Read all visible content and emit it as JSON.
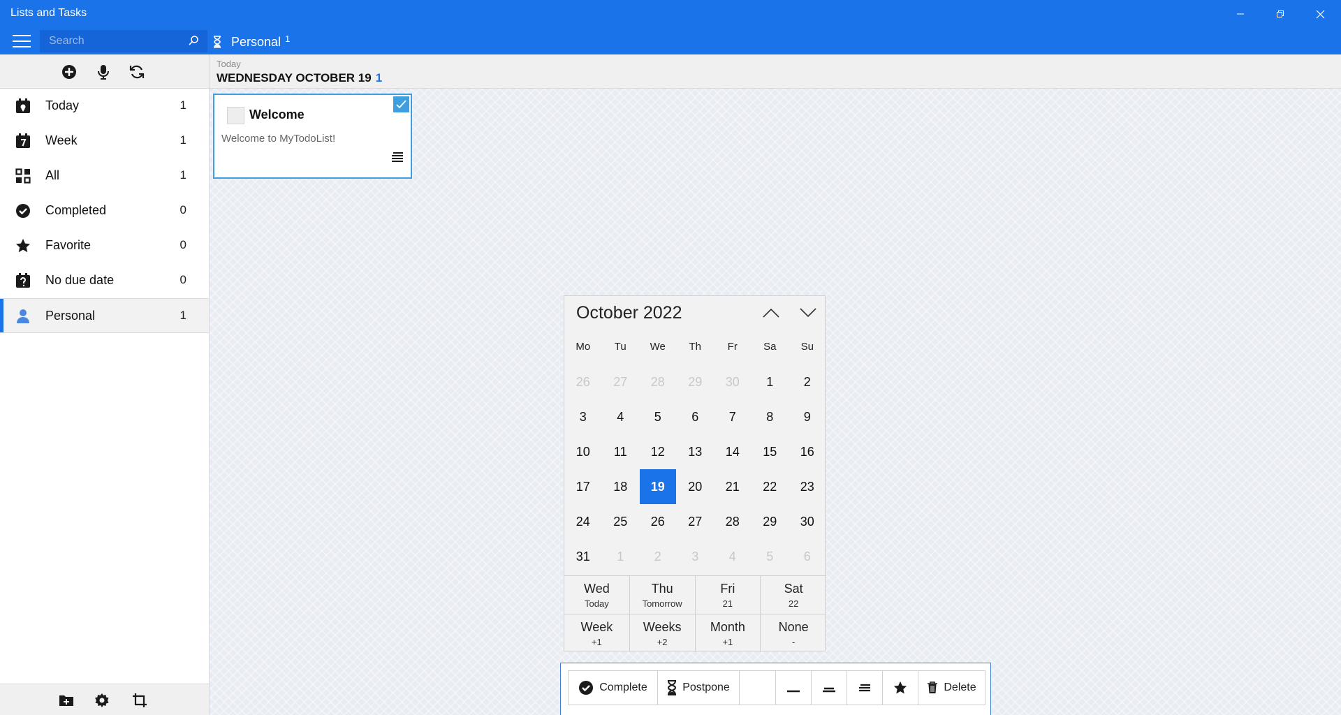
{
  "window": {
    "title": "Lists and Tasks",
    "controls": [
      "minimize-icon",
      "restore-icon",
      "close-icon"
    ]
  },
  "header": {
    "search_placeholder": "Search",
    "list_title": "Personal",
    "list_count": "1"
  },
  "sidebar": {
    "toolbar": [
      "add-icon",
      "microphone-icon",
      "sync-icon"
    ],
    "items": [
      {
        "label": "Today",
        "count": "1",
        "icon": "calendar-today-icon"
      },
      {
        "label": "Week",
        "count": "1",
        "icon": "calendar-week-icon"
      },
      {
        "label": "All",
        "count": "1",
        "icon": "grid-icon"
      },
      {
        "label": "Completed",
        "count": "0",
        "icon": "check-circle-icon"
      },
      {
        "label": "Favorite",
        "count": "0",
        "icon": "star-icon"
      },
      {
        "label": "No due date",
        "count": "0",
        "icon": "calendar-question-icon"
      },
      {
        "label": "Personal",
        "count": "1",
        "icon": "person-icon",
        "selected": true
      }
    ],
    "footer": [
      "add-folder-icon",
      "settings-icon",
      "crop-icon"
    ]
  },
  "main": {
    "today_label": "Today",
    "date_text": "WEDNESDAY OCTOBER 19",
    "date_count": "1",
    "task": {
      "title": "Welcome",
      "description": "Welcome to MyTodoList!"
    }
  },
  "calendar": {
    "month_label": "October 2022",
    "weekdays": [
      "Mo",
      "Tu",
      "We",
      "Th",
      "Fr",
      "Sa",
      "Su"
    ],
    "days": [
      {
        "d": "26",
        "other": true
      },
      {
        "d": "27",
        "other": true
      },
      {
        "d": "28",
        "other": true
      },
      {
        "d": "29",
        "other": true
      },
      {
        "d": "30",
        "other": true
      },
      {
        "d": "1"
      },
      {
        "d": "2"
      },
      {
        "d": "3"
      },
      {
        "d": "4"
      },
      {
        "d": "5"
      },
      {
        "d": "6"
      },
      {
        "d": "7"
      },
      {
        "d": "8"
      },
      {
        "d": "9"
      },
      {
        "d": "10"
      },
      {
        "d": "11"
      },
      {
        "d": "12"
      },
      {
        "d": "13"
      },
      {
        "d": "14"
      },
      {
        "d": "15"
      },
      {
        "d": "16"
      },
      {
        "d": "17"
      },
      {
        "d": "18"
      },
      {
        "d": "19",
        "selected": true
      },
      {
        "d": "20"
      },
      {
        "d": "21"
      },
      {
        "d": "22"
      },
      {
        "d": "23"
      },
      {
        "d": "24"
      },
      {
        "d": "25"
      },
      {
        "d": "26"
      },
      {
        "d": "27"
      },
      {
        "d": "28"
      },
      {
        "d": "29"
      },
      {
        "d": "30"
      },
      {
        "d": "31"
      },
      {
        "d": "1",
        "other": true
      },
      {
        "d": "2",
        "other": true
      },
      {
        "d": "3",
        "other": true
      },
      {
        "d": "4",
        "other": true
      },
      {
        "d": "5",
        "other": true
      },
      {
        "d": "6",
        "other": true
      }
    ],
    "quick_row1": [
      {
        "main": "Wed",
        "sub": "Today"
      },
      {
        "main": "Thu",
        "sub": "Tomorrow"
      },
      {
        "main": "Fri",
        "sub": "21"
      },
      {
        "main": "Sat",
        "sub": "22"
      }
    ],
    "quick_row2": [
      {
        "main": "Week",
        "sub": "+1"
      },
      {
        "main": "Weeks",
        "sub": "+2"
      },
      {
        "main": "Month",
        "sub": "+1"
      },
      {
        "main": "None",
        "sub": "-"
      }
    ]
  },
  "commands": {
    "complete": "Complete",
    "postpone": "Postpone",
    "delete": "Delete"
  },
  "colors": {
    "accent": "#1a73e8",
    "selection": "#3d9ee0"
  }
}
